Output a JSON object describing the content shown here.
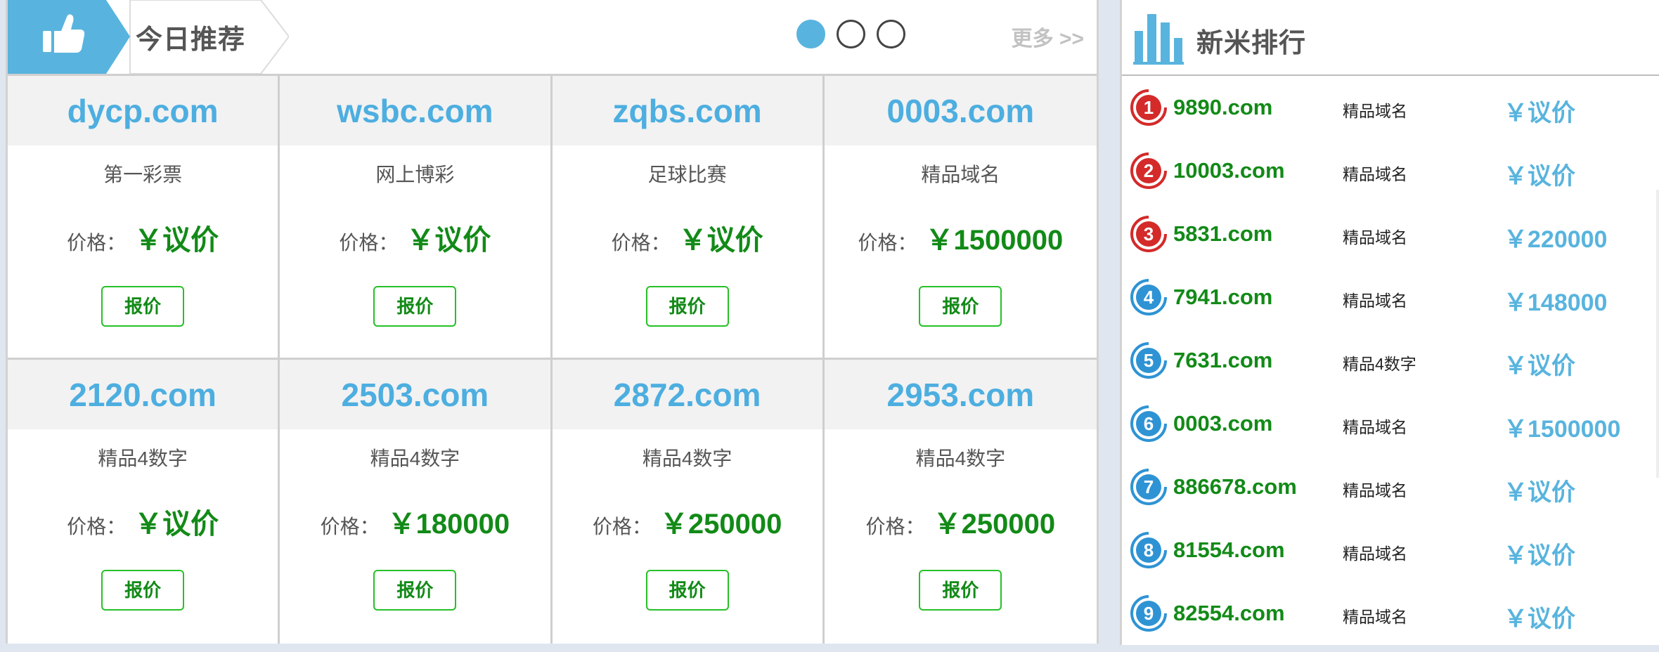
{
  "recommend": {
    "title": "今日推荐",
    "more": "更多 >>",
    "dots": [
      "1",
      "2",
      "3"
    ],
    "price_label": "价格：",
    "quote_label": "报价",
    "cards": [
      {
        "domain": "dycp.com",
        "desc": "第一彩票",
        "price": "￥议价"
      },
      {
        "domain": "wsbc.com",
        "desc": "网上博彩",
        "price": "￥议价"
      },
      {
        "domain": "zqbs.com",
        "desc": "足球比赛",
        "price": "￥议价"
      },
      {
        "domain": "0003.com",
        "desc": "精品域名",
        "price": "￥1500000"
      },
      {
        "domain": "2120.com",
        "desc": "精品4数字",
        "price": "￥议价"
      },
      {
        "domain": "2503.com",
        "desc": "精品4数字",
        "price": "￥180000"
      },
      {
        "domain": "2872.com",
        "desc": "精品4数字",
        "price": "￥250000"
      },
      {
        "domain": "2953.com",
        "desc": "精品4数字",
        "price": "￥250000"
      }
    ]
  },
  "ranking": {
    "title": "新米排行",
    "items": [
      {
        "rank": "1",
        "domain": "9890.com",
        "category": "精品域名",
        "price": "￥议价"
      },
      {
        "rank": "2",
        "domain": "10003.com",
        "category": "精品域名",
        "price": "￥议价"
      },
      {
        "rank": "3",
        "domain": "5831.com",
        "category": "精品域名",
        "price": "￥220000"
      },
      {
        "rank": "4",
        "domain": "7941.com",
        "category": "精品域名",
        "price": "￥148000"
      },
      {
        "rank": "5",
        "domain": "7631.com",
        "category": "精品4数字",
        "price": "￥议价"
      },
      {
        "rank": "6",
        "domain": "0003.com",
        "category": "精品域名",
        "price": "￥1500000"
      },
      {
        "rank": "7",
        "domain": "886678.com",
        "category": "精品域名",
        "price": "￥议价"
      },
      {
        "rank": "8",
        "domain": "81554.com",
        "category": "精品域名",
        "price": "￥议价"
      },
      {
        "rank": "9",
        "domain": "82554.com",
        "category": "精品域名",
        "price": "￥议价"
      }
    ]
  },
  "colors": {
    "accent_blue": "#58b4de",
    "domain_blue": "#4daee0",
    "price_green": "#128a17",
    "badge_red": "#d42a2a",
    "badge_blue": "#2e93d4"
  },
  "icons": {
    "recommend": "thumbs-up-icon",
    "ranking": "bar-chart-icon"
  }
}
